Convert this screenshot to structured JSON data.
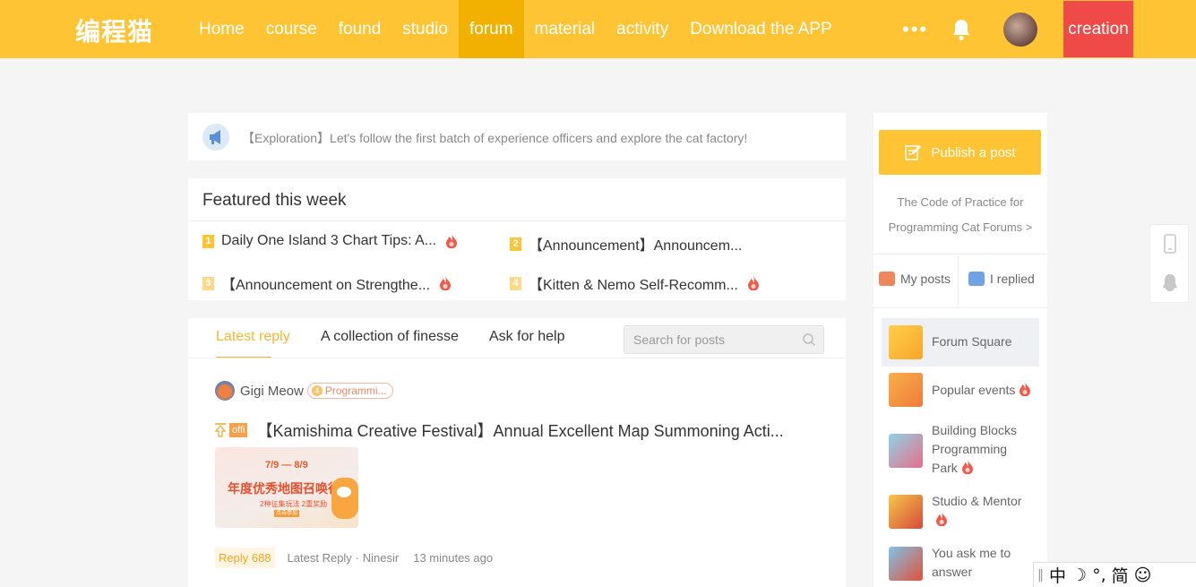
{
  "nav": {
    "logo": "编程猫",
    "items": [
      "Home",
      "course",
      "found",
      "studio",
      "forum",
      "material",
      "activity",
      "Download the APP"
    ],
    "active": "forum",
    "more": "•••",
    "create_label": "creation"
  },
  "announcement": {
    "text": "【Exploration】Let's follow the first batch of experience officers and explore the cat factory!"
  },
  "featured": {
    "title": "Featured this week",
    "items": [
      {
        "rank": "1",
        "text": "Daily One Island 3 Chart Tips: A..."
      },
      {
        "rank": "2",
        "text": "【Announcement】Announcem..."
      },
      {
        "rank": "3",
        "text": "【Announcement on Strengthe..."
      },
      {
        "rank": "4",
        "text": "【Kitten & Nemo Self-Recomm..."
      }
    ]
  },
  "tabs": [
    "Latest reply",
    "A collection of finesse",
    "Ask for help"
  ],
  "search": {
    "placeholder": "Search for posts"
  },
  "post": {
    "author": "Gigi Meow",
    "badge_level": "4",
    "badge": "Programmi...",
    "official_tag": "offi",
    "title": "【Kamishima Creative Festival】Annual Excellent Map Summoning Acti...",
    "image_dates": "7/9 — 8/9",
    "image_text": "年度优秀地图召唤行动",
    "image_sub": "2种征集玩法  2重奖励",
    "image_btn": "点击参加",
    "reply": "Reply 688",
    "latest_reply_label": "Latest Reply ·",
    "latest_reply_user": "Ninesir",
    "time": "13 minutes ago"
  },
  "sidebar": {
    "publish": "Publish a post",
    "code_line1": "The Code of Practice for",
    "code_line2": "Programming Cat Forums >",
    "my_posts": "My posts",
    "replied": "I replied",
    "sections": [
      {
        "label": "Forum Square",
        "hot": false
      },
      {
        "label": "Popular events",
        "hot": true
      },
      {
        "label": "Building Blocks Programming Park",
        "hot": true
      },
      {
        "label": "Studio & Mentor",
        "hot": true
      },
      {
        "label": "You ask me to answer",
        "hot": false
      }
    ]
  },
  "ime": {
    "items": [
      "中",
      "☽",
      "°,",
      "简",
      "☺"
    ]
  },
  "colors": {
    "brand": "#fec433",
    "create": "#ef4a48",
    "accent": "#f6b631"
  }
}
